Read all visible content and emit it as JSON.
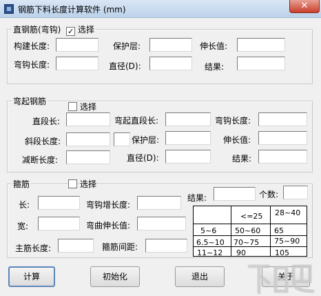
{
  "window": {
    "title": "钢筋下料长度计算软件 (mm)",
    "close_glyph": "✕"
  },
  "straight": {
    "group_title": "直钢筋(弯钩)",
    "checkbox_label": "选择",
    "checked": true,
    "check_glyph": "✓",
    "labels": {
      "member_length": "构建长度:",
      "cover": "保护层:",
      "elongation": "伸长值:",
      "hook_length": "弯钩长度:",
      "diameter": "直径(D):",
      "result": "结果:"
    }
  },
  "bent": {
    "group_title": "弯起钢筋",
    "checkbox_label": "选择",
    "checked": false,
    "labels": {
      "straight_segment": "直段长:",
      "bent_straight_segment": "弯起直段长:",
      "hook_length": "弯钩长度:",
      "oblique_length": "斜段长度:",
      "cover": "保护层:",
      "elongation": "伸长值:",
      "shortened_length": "减断长度:",
      "diameter": "直径(D):",
      "result": "结果:"
    }
  },
  "stirrup": {
    "group_title": "箍筋",
    "checkbox_label": "选择",
    "checked": false,
    "labels": {
      "length": "长:",
      "hook_increase": "弯钩增长度:",
      "result": "结果:",
      "count": "个数:",
      "width": "宽:",
      "bend_elongation": "弯曲伸长值:",
      "main_bar_length": "主筋长度:",
      "stirrup_spacing": "箍筋间距:"
    },
    "ref_table": {
      "rows": [
        [
          "",
          "<=25",
          "28~40"
        ],
        [
          "5~6",
          "50~60",
          "65"
        ],
        [
          "6.5~10",
          "70~75",
          "75~90"
        ],
        [
          "11~12",
          "90",
          "105"
        ]
      ]
    }
  },
  "buttons": {
    "calculate": "计算",
    "initialize": "初始化",
    "exit": "退出",
    "about": "关于"
  },
  "watermark": {
    "text": "下载吧"
  }
}
